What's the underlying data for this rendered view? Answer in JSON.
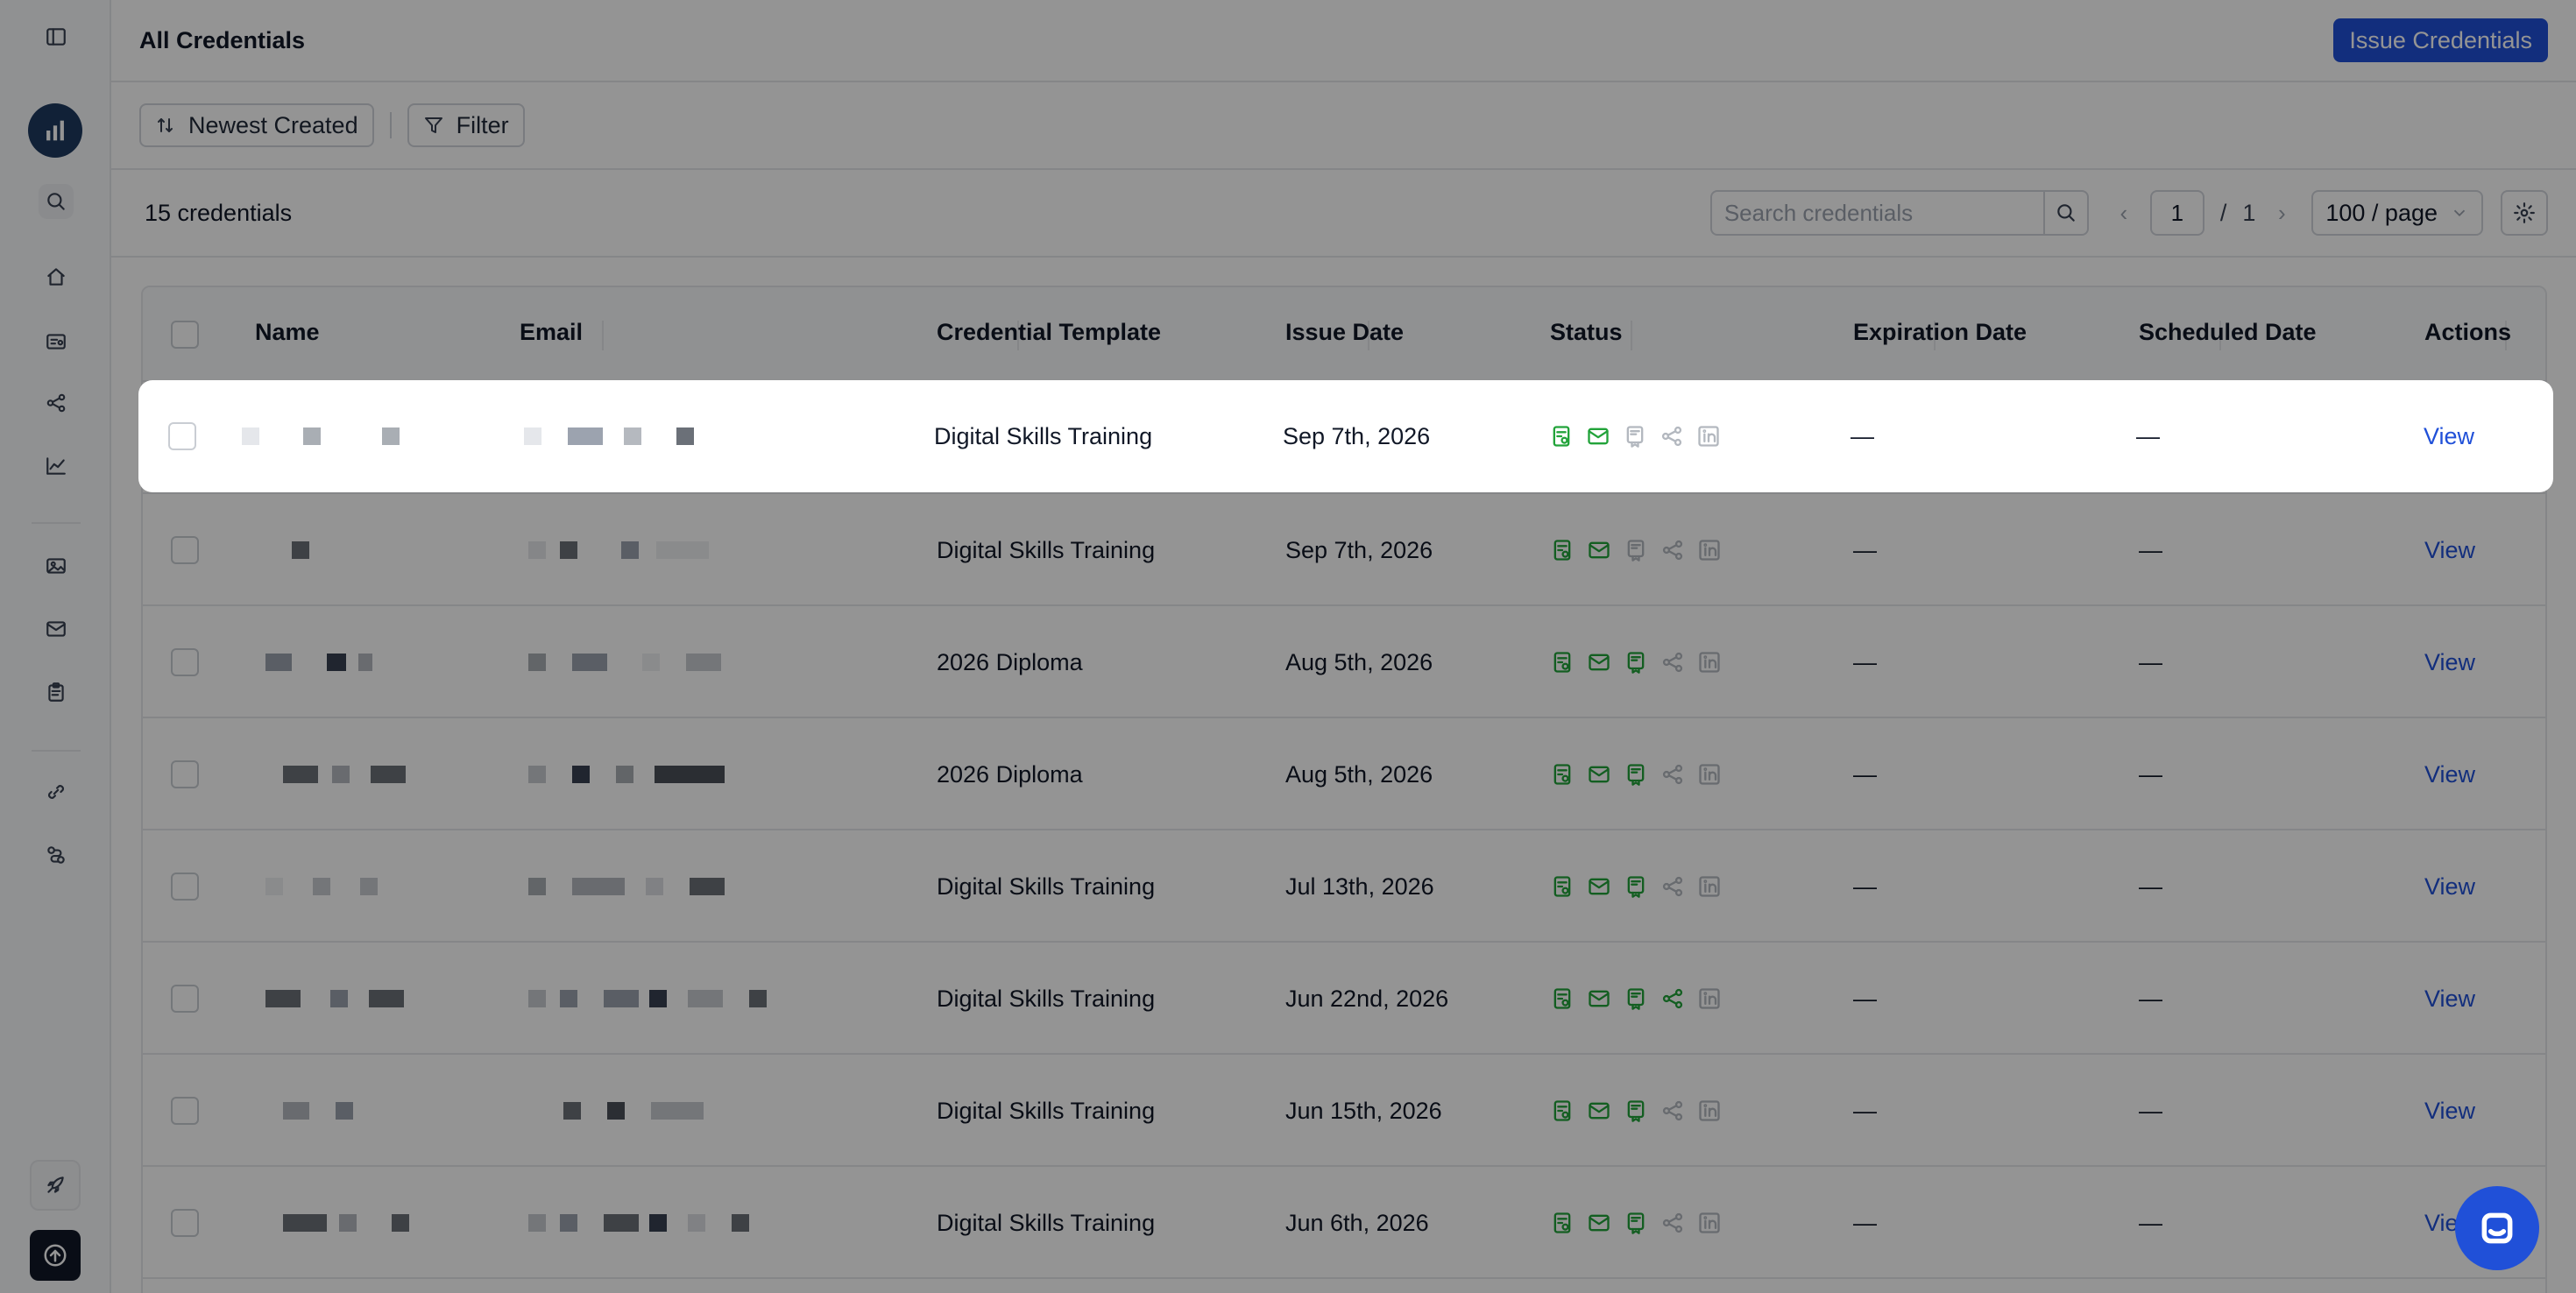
{
  "header": {
    "title": "All Credentials",
    "issue_button": "Issue Credentials"
  },
  "toolbar": {
    "sort_label": "Newest Created",
    "filter_label": "Filter"
  },
  "listbar": {
    "count": "15 credentials",
    "search_placeholder": "Search credentials",
    "page_current": "1",
    "page_sep": "/",
    "page_total": "1",
    "page_size": "100 / page"
  },
  "table": {
    "columns": [
      "Name",
      "Email",
      "Credential Template",
      "Issue Date",
      "Status",
      "Expiration Date",
      "Scheduled Date",
      "Actions"
    ],
    "rows": [
      {
        "template": "Digital Skills Training",
        "issue_date": "Sep 7th, 2026",
        "expiration": "—",
        "scheduled": "—",
        "action": "View",
        "status": [
          true,
          true,
          false,
          false,
          false
        ]
      },
      {
        "template": "Digital Skills Training",
        "issue_date": "Sep 7th, 2026",
        "expiration": "—",
        "scheduled": "—",
        "action": "View",
        "status": [
          true,
          true,
          false,
          false,
          false
        ]
      },
      {
        "template": "2026 Diploma",
        "issue_date": "Aug 5th, 2026",
        "expiration": "—",
        "scheduled": "—",
        "action": "View",
        "status": [
          true,
          true,
          true,
          false,
          false
        ]
      },
      {
        "template": "2026 Diploma",
        "issue_date": "Aug 5th, 2026",
        "expiration": "—",
        "scheduled": "—",
        "action": "View",
        "status": [
          true,
          true,
          true,
          false,
          false
        ]
      },
      {
        "template": "Digital Skills Training",
        "issue_date": "Jul 13th, 2026",
        "expiration": "—",
        "scheduled": "—",
        "action": "View",
        "status": [
          true,
          true,
          true,
          false,
          false
        ]
      },
      {
        "template": "Digital Skills Training",
        "issue_date": "Jun 22nd, 2026",
        "expiration": "—",
        "scheduled": "—",
        "action": "View",
        "status": [
          true,
          true,
          true,
          true,
          false
        ]
      },
      {
        "template": "Digital Skills Training",
        "issue_date": "Jun 15th, 2026",
        "expiration": "—",
        "scheduled": "—",
        "action": "View",
        "status": [
          true,
          true,
          true,
          false,
          false
        ]
      },
      {
        "template": "Digital Skills Training",
        "issue_date": "Jun 6th, 2026",
        "expiration": "—",
        "scheduled": "—",
        "action": "View",
        "status": [
          true,
          true,
          true,
          false,
          false
        ]
      }
    ]
  },
  "colors": {
    "accent": "#2050d8",
    "status_on": "#22a33a",
    "status_off": "#b3b8bf"
  }
}
